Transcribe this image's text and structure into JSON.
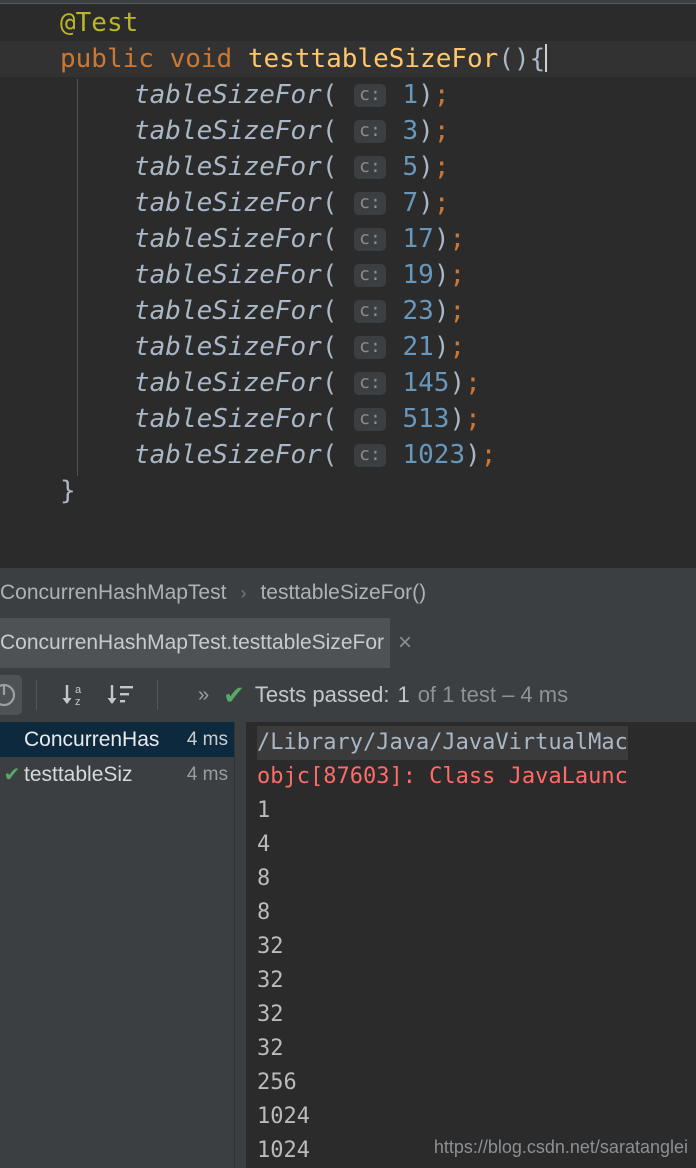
{
  "editor": {
    "lines": [
      {
        "type": "annotation",
        "text": "@Test",
        "current": false
      },
      {
        "type": "signature",
        "kw1": "public",
        "kw2": "void",
        "name": "testtableSizeFor",
        "tail": "(){",
        "current": true
      },
      {
        "type": "call",
        "fn": "tableSizeFor",
        "hint": "c:",
        "arg": "1",
        "current": false
      },
      {
        "type": "call",
        "fn": "tableSizeFor",
        "hint": "c:",
        "arg": "3",
        "current": false
      },
      {
        "type": "call",
        "fn": "tableSizeFor",
        "hint": "c:",
        "arg": "5",
        "current": false
      },
      {
        "type": "call",
        "fn": "tableSizeFor",
        "hint": "c:",
        "arg": "7",
        "current": false
      },
      {
        "type": "call",
        "fn": "tableSizeFor",
        "hint": "c:",
        "arg": "17",
        "current": false
      },
      {
        "type": "call",
        "fn": "tableSizeFor",
        "hint": "c:",
        "arg": "19",
        "current": false
      },
      {
        "type": "call",
        "fn": "tableSizeFor",
        "hint": "c:",
        "arg": "23",
        "current": false
      },
      {
        "type": "call",
        "fn": "tableSizeFor",
        "hint": "c:",
        "arg": "21",
        "current": false
      },
      {
        "type": "call",
        "fn": "tableSizeFor",
        "hint": "c:",
        "arg": "145",
        "current": false
      },
      {
        "type": "call",
        "fn": "tableSizeFor",
        "hint": "c:",
        "arg": "513",
        "current": false
      },
      {
        "type": "call",
        "fn": "tableSizeFor",
        "hint": "c:",
        "arg": "1023",
        "current": false
      },
      {
        "type": "brace",
        "text": "}",
        "current": false
      }
    ],
    "colors": {
      "background": "#2b2b2b",
      "annotation": "#BBB529",
      "keyword": "#CC7832",
      "method_name": "#FFC66D",
      "identifier": "#A9B7C6",
      "number": "#6897BB",
      "hint_text": "#8C8C8C"
    }
  },
  "breadcrumb": {
    "items": [
      "ConcurrenHashMapTest",
      "testtableSizeFor()"
    ],
    "separator": "›"
  },
  "run_tab": {
    "label": "ConcurrenHashMapTest.testtableSizeFor",
    "close_icon": "×"
  },
  "run_toolbar": {
    "rerun_icon": "rerun-icon",
    "sort_alpha_label": "a\nz",
    "sort_duration_icon": "sort-by-duration-icon",
    "expand_chevrons": "»",
    "status_check": "✔",
    "status_prefix": "Tests passed:",
    "status_count": "1",
    "status_suffix": "of 1 test – 4 ms"
  },
  "test_tree": {
    "rows": [
      {
        "label": "ConcurrenHas",
        "time": "4 ms",
        "selected": true,
        "icon": ""
      },
      {
        "label": "testtableSiz",
        "time": "4 ms",
        "selected": false,
        "icon": "✔"
      }
    ],
    "selection_color": "#0D293E",
    "pass_color": "#59A869"
  },
  "console": {
    "lines": [
      {
        "text": "/Library/Java/JavaVirtualMac",
        "style": "path"
      },
      {
        "text": "objc[87603]: Class JavaLaunc",
        "style": "error"
      },
      {
        "text": "1",
        "style": "out"
      },
      {
        "text": "4",
        "style": "out"
      },
      {
        "text": "8",
        "style": "out"
      },
      {
        "text": "8",
        "style": "out"
      },
      {
        "text": "32",
        "style": "out"
      },
      {
        "text": "32",
        "style": "out"
      },
      {
        "text": "32",
        "style": "out"
      },
      {
        "text": "32",
        "style": "out"
      },
      {
        "text": "256",
        "style": "out"
      },
      {
        "text": "1024",
        "style": "out"
      },
      {
        "text": "1024",
        "style": "out"
      }
    ],
    "error_color": "#FF6B68",
    "output_color": "#BBBBBB"
  },
  "watermark": {
    "text": "https://blog.csdn.net/saratanglei"
  }
}
